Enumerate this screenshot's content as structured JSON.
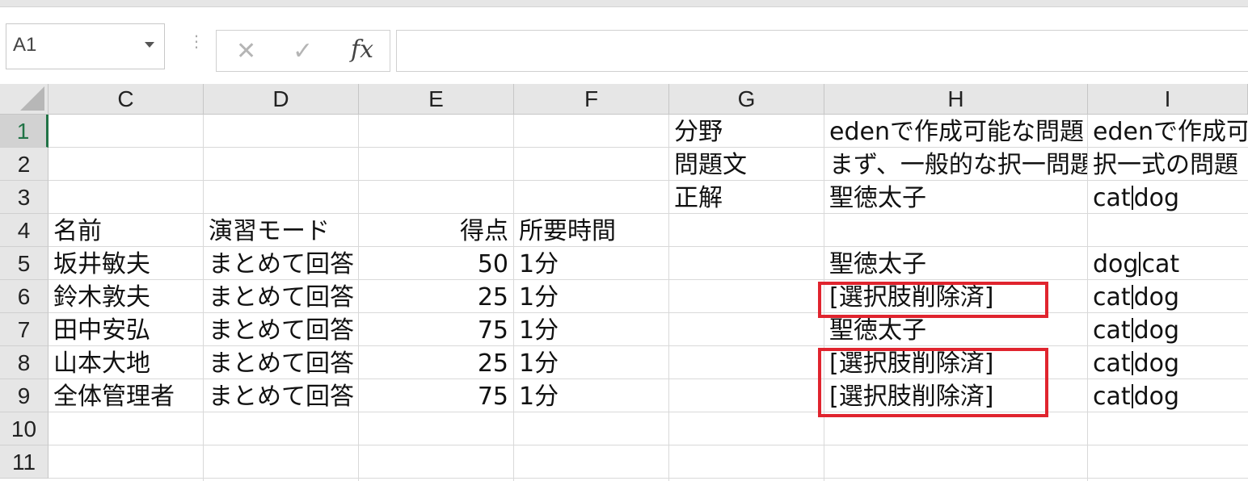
{
  "formula_bar": {
    "name_box": "A1",
    "cancel_icon": "✕",
    "enter_icon": "✓",
    "fx_label": "fx",
    "formula": ""
  },
  "columns": [
    "C",
    "D",
    "E",
    "F",
    "G",
    "H",
    "I"
  ],
  "rows": [
    "1",
    "2",
    "3",
    "4",
    "5",
    "6",
    "7",
    "8",
    "9",
    "10",
    "11"
  ],
  "active_row": "1",
  "cells": {
    "G1": "分野",
    "H1": "edenで作成可能な問題",
    "I1": "edenで作成可能な",
    "G2": "問題文",
    "H2": "まず、一般的な択一問題",
    "I2": "択一式の問題",
    "G3": "正解",
    "H3": "聖徳太子",
    "I3": [
      "cat",
      "dog"
    ],
    "C4": "名前",
    "D4": "演習モード",
    "E4": "得点",
    "F4": "所要時間",
    "C5": "坂井敏夫",
    "D5": "まとめて回答",
    "E5": "50",
    "F5": "1分",
    "H5": "聖徳太子",
    "I5": [
      "dog",
      "cat"
    ],
    "C6": "鈴木敦夫",
    "D6": "まとめて回答",
    "E6": "25",
    "F6": "1分",
    "H6": "[選択肢削除済]",
    "I6": [
      "cat",
      "dog"
    ],
    "C7": "田中安弘",
    "D7": "まとめて回答",
    "E7": "75",
    "F7": "1分",
    "H7": "聖徳太子",
    "I7": [
      "cat",
      "dog"
    ],
    "C8": "山本大地",
    "D8": "まとめて回答",
    "E8": "25",
    "F8": "1分",
    "H8": "[選択肢削除済]",
    "I8": [
      "cat",
      "dog"
    ],
    "C9": "全体管理者",
    "D9": "まとめて回答",
    "E9": "75",
    "F9": "1分",
    "H9": "[選択肢削除済]",
    "I9": [
      "cat",
      "dog"
    ]
  },
  "highlight_color": "#e0242e",
  "accent_color": "#217346"
}
